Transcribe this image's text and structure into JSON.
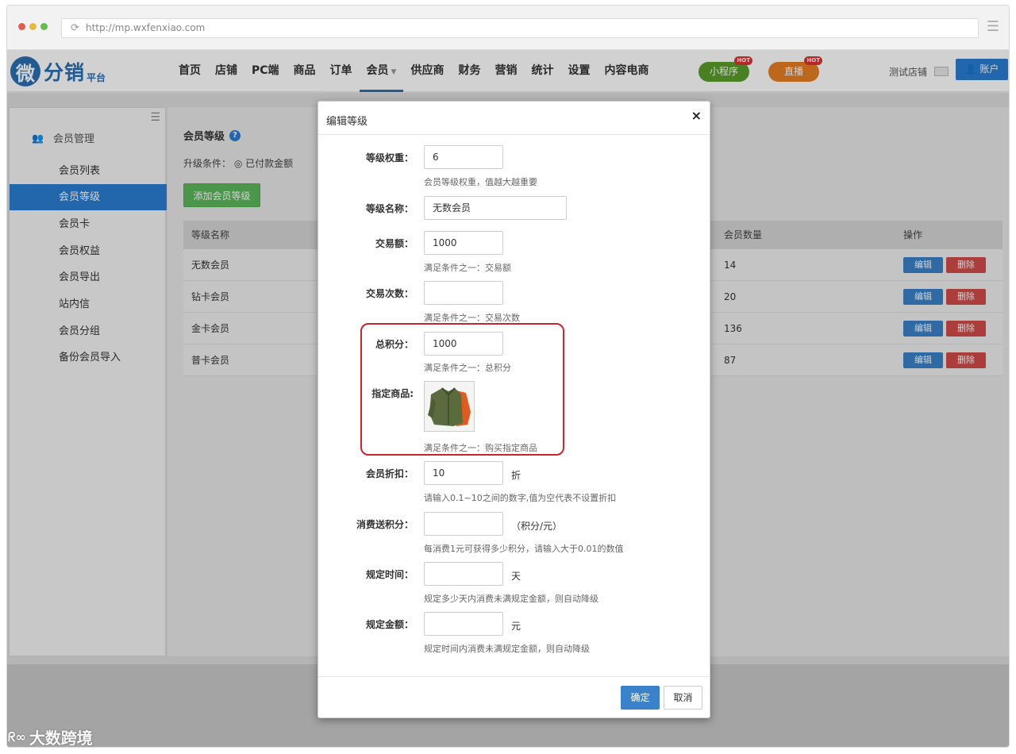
{
  "browser": {
    "url": "http://mp.wxfenxiao.com",
    "dot_colors": [
      "#e55a4f",
      "#e8b83a",
      "#5fbf4a"
    ]
  },
  "logo": {
    "circle": "微",
    "text": "分销",
    "sub": "平台"
  },
  "nav": {
    "items": [
      "首页",
      "店铺",
      "PC端",
      "商品",
      "订单",
      "会员",
      "供应商",
      "财务",
      "营销",
      "统计",
      "设置",
      "内容电商"
    ],
    "active": "会员",
    "pill_miniprogram": "小程序",
    "pill_live": "直播",
    "hot": "HOT",
    "shop_name": "测试店铺",
    "account": "账户"
  },
  "sidebar": {
    "header": "会员管理",
    "items": [
      "会员列表",
      "会员等级",
      "会员卡",
      "会员权益",
      "会员导出",
      "站内信",
      "会员分组",
      "备份会员导入"
    ],
    "active": "会员等级"
  },
  "main": {
    "title": "会员等级",
    "upgrade_label": "升级条件：",
    "upgrade_option": "已付款金额",
    "add_button": "添加会员等级",
    "table": {
      "headers": [
        "等级名称",
        "会员数量",
        "操作"
      ],
      "rows": [
        {
          "name": "无数会员",
          "count": "14"
        },
        {
          "name": "钻卡会员",
          "count": "20"
        },
        {
          "name": "金卡会员",
          "count": "136"
        },
        {
          "name": "普卡会员",
          "count": "87"
        }
      ],
      "edit_label": "编辑",
      "delete_label": "删除"
    }
  },
  "modal": {
    "title": "编辑等级",
    "close": "×",
    "fields": {
      "weight": {
        "label": "等级权重：",
        "value": "6",
        "hint": "会员等级权重，值越大越重要"
      },
      "name": {
        "label": "等级名称：",
        "value": "无数会员"
      },
      "amount": {
        "label": "交易额：",
        "value": "1000",
        "hint": "满足条件之一：交易额"
      },
      "times": {
        "label": "交易次数：",
        "value": "",
        "hint": "满足条件之一：交易次数"
      },
      "points": {
        "label": "总积分：",
        "value": "1000",
        "hint": "满足条件之一：总积分"
      },
      "product": {
        "label": "指定商品:",
        "hint": "满足条件之一：购买指定商品"
      },
      "discount": {
        "label": "会员折扣：",
        "value": "10",
        "unit": "折",
        "hint": "请输入0.1~10之间的数字,值为空代表不设置折扣"
      },
      "reward": {
        "label": "消费送积分：",
        "value": "",
        "unit": "（积分/元）",
        "hint": "每消费1元可获得多少积分，请输入大于0.01的数值"
      },
      "period": {
        "label": "规定时间：",
        "value": "",
        "unit": "天",
        "hint": "规定多少天内消费未满规定金额，则自动降级"
      },
      "min_amount": {
        "label": "规定金额：",
        "value": "",
        "unit": "元",
        "hint": "规定时间内消费未满规定金额，则自动降级"
      }
    },
    "ok": "确定",
    "cancel": "取消"
  },
  "watermark": "大数跨境"
}
